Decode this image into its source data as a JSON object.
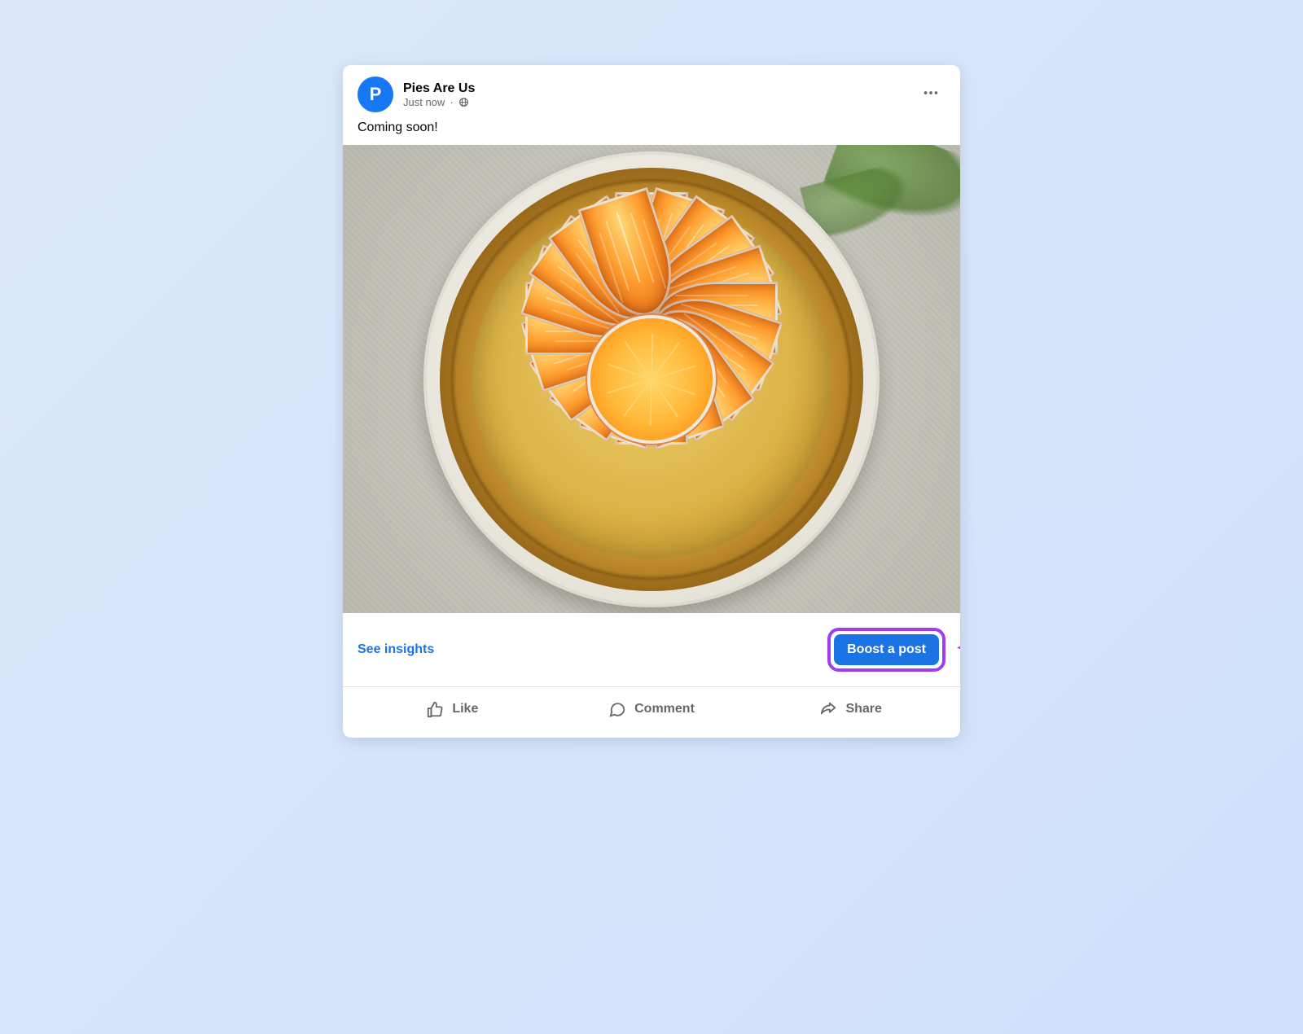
{
  "post": {
    "avatar_letter": "P",
    "page_name": "Pies Are Us",
    "time": "Just now",
    "audience": "Public",
    "text": "Coming soon!"
  },
  "insights": {
    "link_label": "See insights",
    "boost_label": "Boost a post"
  },
  "actions": {
    "like": "Like",
    "comment": "Comment",
    "share": "Share"
  },
  "colors": {
    "primary": "#1b74e4",
    "highlight": "#a23cf0"
  }
}
